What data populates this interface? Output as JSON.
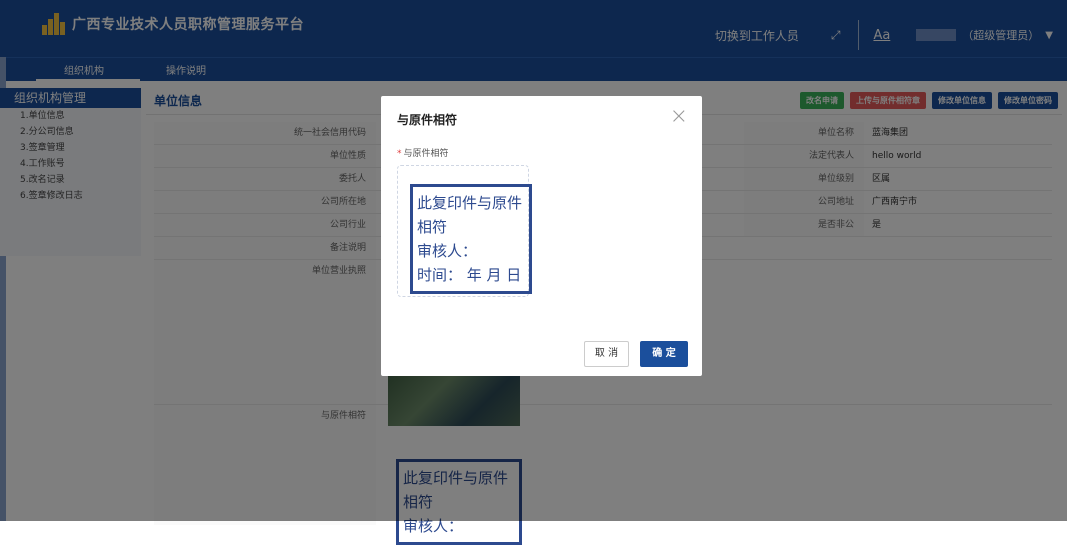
{
  "header": {
    "app_title": "广西专业技术人员职称管理服务平台",
    "switch_label": "切换到工作人员",
    "font_size_label": "Aa",
    "user_role": "（超级管理员）",
    "subnav": {
      "active": "组织机构",
      "ops": "操作说明"
    }
  },
  "sidebar": {
    "title": "组织机构管理",
    "items": [
      {
        "label": "1.单位信息"
      },
      {
        "label": "2.分公司信息"
      },
      {
        "label": "3.签章管理"
      },
      {
        "label": "4.工作账号"
      },
      {
        "label": "5.改名记录"
      },
      {
        "label": "6.签章修改日志"
      }
    ]
  },
  "main": {
    "title": "单位信息",
    "actions": {
      "rename": "改名申请",
      "upload": "上传与原件相符章",
      "edit_info": "修改单位信息",
      "edit_pwd": "修改单位密码"
    },
    "rows": [
      {
        "l1": "统一社会信用代码",
        "v1": "",
        "l2": "单位名称",
        "v2": "蓝海集团"
      },
      {
        "l1": "单位性质",
        "v1": "",
        "l2": "法定代表人",
        "v2": "hello world"
      },
      {
        "l1": "委托人",
        "v1": "",
        "l2": "单位级别",
        "v2": "区属"
      },
      {
        "l1": "公司所在地",
        "v1": "",
        "l2": "公司地址",
        "v2": "广西南宁市"
      },
      {
        "l1": "公司行业",
        "v1": "",
        "l2": "是否非公",
        "v2": "是"
      },
      {
        "l1": "备注说明",
        "v1": ""
      }
    ],
    "license_label": "单位营业执照",
    "copy_label": "与原件相符",
    "stamp_bg": {
      "line1": "此复印件与原件相符",
      "line2": "审核人："
    }
  },
  "modal": {
    "title": "与原件相符",
    "field_label": "与原件相符",
    "stamp": {
      "line1": "此复印件与原件相符",
      "line2": "审核人：",
      "line3": "时间：  年  月  日"
    },
    "cancel": "取 消",
    "ok": "确 定"
  }
}
